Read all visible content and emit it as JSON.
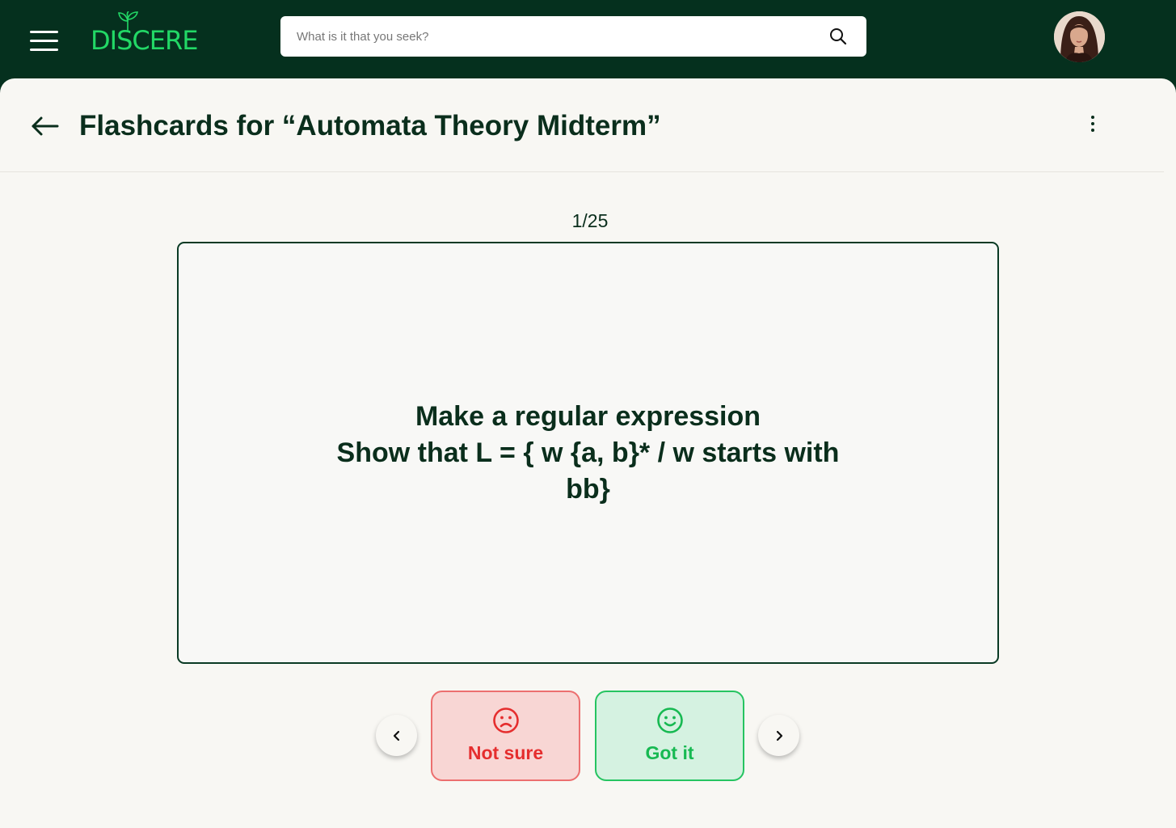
{
  "app": {
    "logo_text": "DISCERE",
    "brand_color": "#22d866",
    "topbar_color": "#05301e"
  },
  "search": {
    "placeholder": "What is it that you seek?",
    "value": ""
  },
  "header": {
    "title": "Flashcards for “Automata Theory Midterm”"
  },
  "flashcard": {
    "counter": "1/25",
    "current": 1,
    "total": 25,
    "line1": "Make a regular expression",
    "line2": "Show that L = { w  {a, b}* / w starts with bb}"
  },
  "actions": {
    "not_sure_label": "Not sure",
    "not_sure_icon": "sad-face-icon",
    "got_it_label": "Got it",
    "got_it_icon": "smile-face-icon",
    "prev_icon": "chevron-left-icon",
    "next_icon": "chevron-right-icon"
  },
  "colors": {
    "not_sure": "#e52e2e",
    "got_it": "#17b952",
    "title": "#0a2e1c"
  }
}
